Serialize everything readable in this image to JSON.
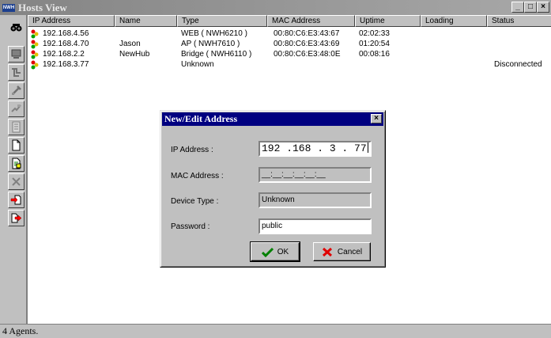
{
  "window": {
    "title": "Hosts View",
    "app_icon_text": "NWH"
  },
  "title_buttons": {
    "minimize": "_",
    "maximize": "□",
    "close": "×"
  },
  "columns": [
    "IP Address",
    "Name",
    "Type",
    "MAC Address",
    "Uptime",
    "Loading",
    "Status"
  ],
  "rows": [
    {
      "ip": "192.168.4.56",
      "name": "",
      "type": "WEB ( NWH6210 )",
      "mac": "00:80:C6:E3:43:67",
      "uptime": "02:02:33",
      "loading": "",
      "status": ""
    },
    {
      "ip": "192.168.4.70",
      "name": "Jason",
      "type": "AP ( NWH7610 )",
      "mac": "00:80:C6:E3:43:69",
      "uptime": "01:20:54",
      "loading": "",
      "status": ""
    },
    {
      "ip": "192.168.2.2",
      "name": "NewHub",
      "type": "Bridge ( NWH6110 )",
      "mac": "00:80:C6:E3:48:0E",
      "uptime": "00:08:16",
      "loading": "",
      "status": ""
    },
    {
      "ip": "192.168.3.77",
      "name": "",
      "type": "Unknown",
      "mac": "",
      "uptime": "",
      "loading": "",
      "status": "Disconnected"
    }
  ],
  "toolbar_icons": [
    "find-icon",
    "monitor-icon",
    "network-icon",
    "tools-icon",
    "config-icon",
    "report-icon",
    "new-document-icon",
    "edit-document-icon",
    "delete-icon",
    "import-icon",
    "export-icon"
  ],
  "dialog": {
    "title": "New/Edit Address",
    "close": "×",
    "ip_label": "IP Address :",
    "ip_value": "192 .168 .  3  . 77",
    "mac_label": "MAC Address :",
    "mac_value": "__:__:__:__:__:__",
    "device_type_label": "Device Type :",
    "device_type_value": "Unknown",
    "password_label": "Password :",
    "password_value": "public",
    "ok_label": "OK",
    "cancel_label": "Cancel"
  },
  "status_bar": {
    "text": "4 Agents."
  },
  "colors": {
    "title_active": "#000080",
    "title_inactive": "#848484",
    "face": "#c0c0c0"
  }
}
